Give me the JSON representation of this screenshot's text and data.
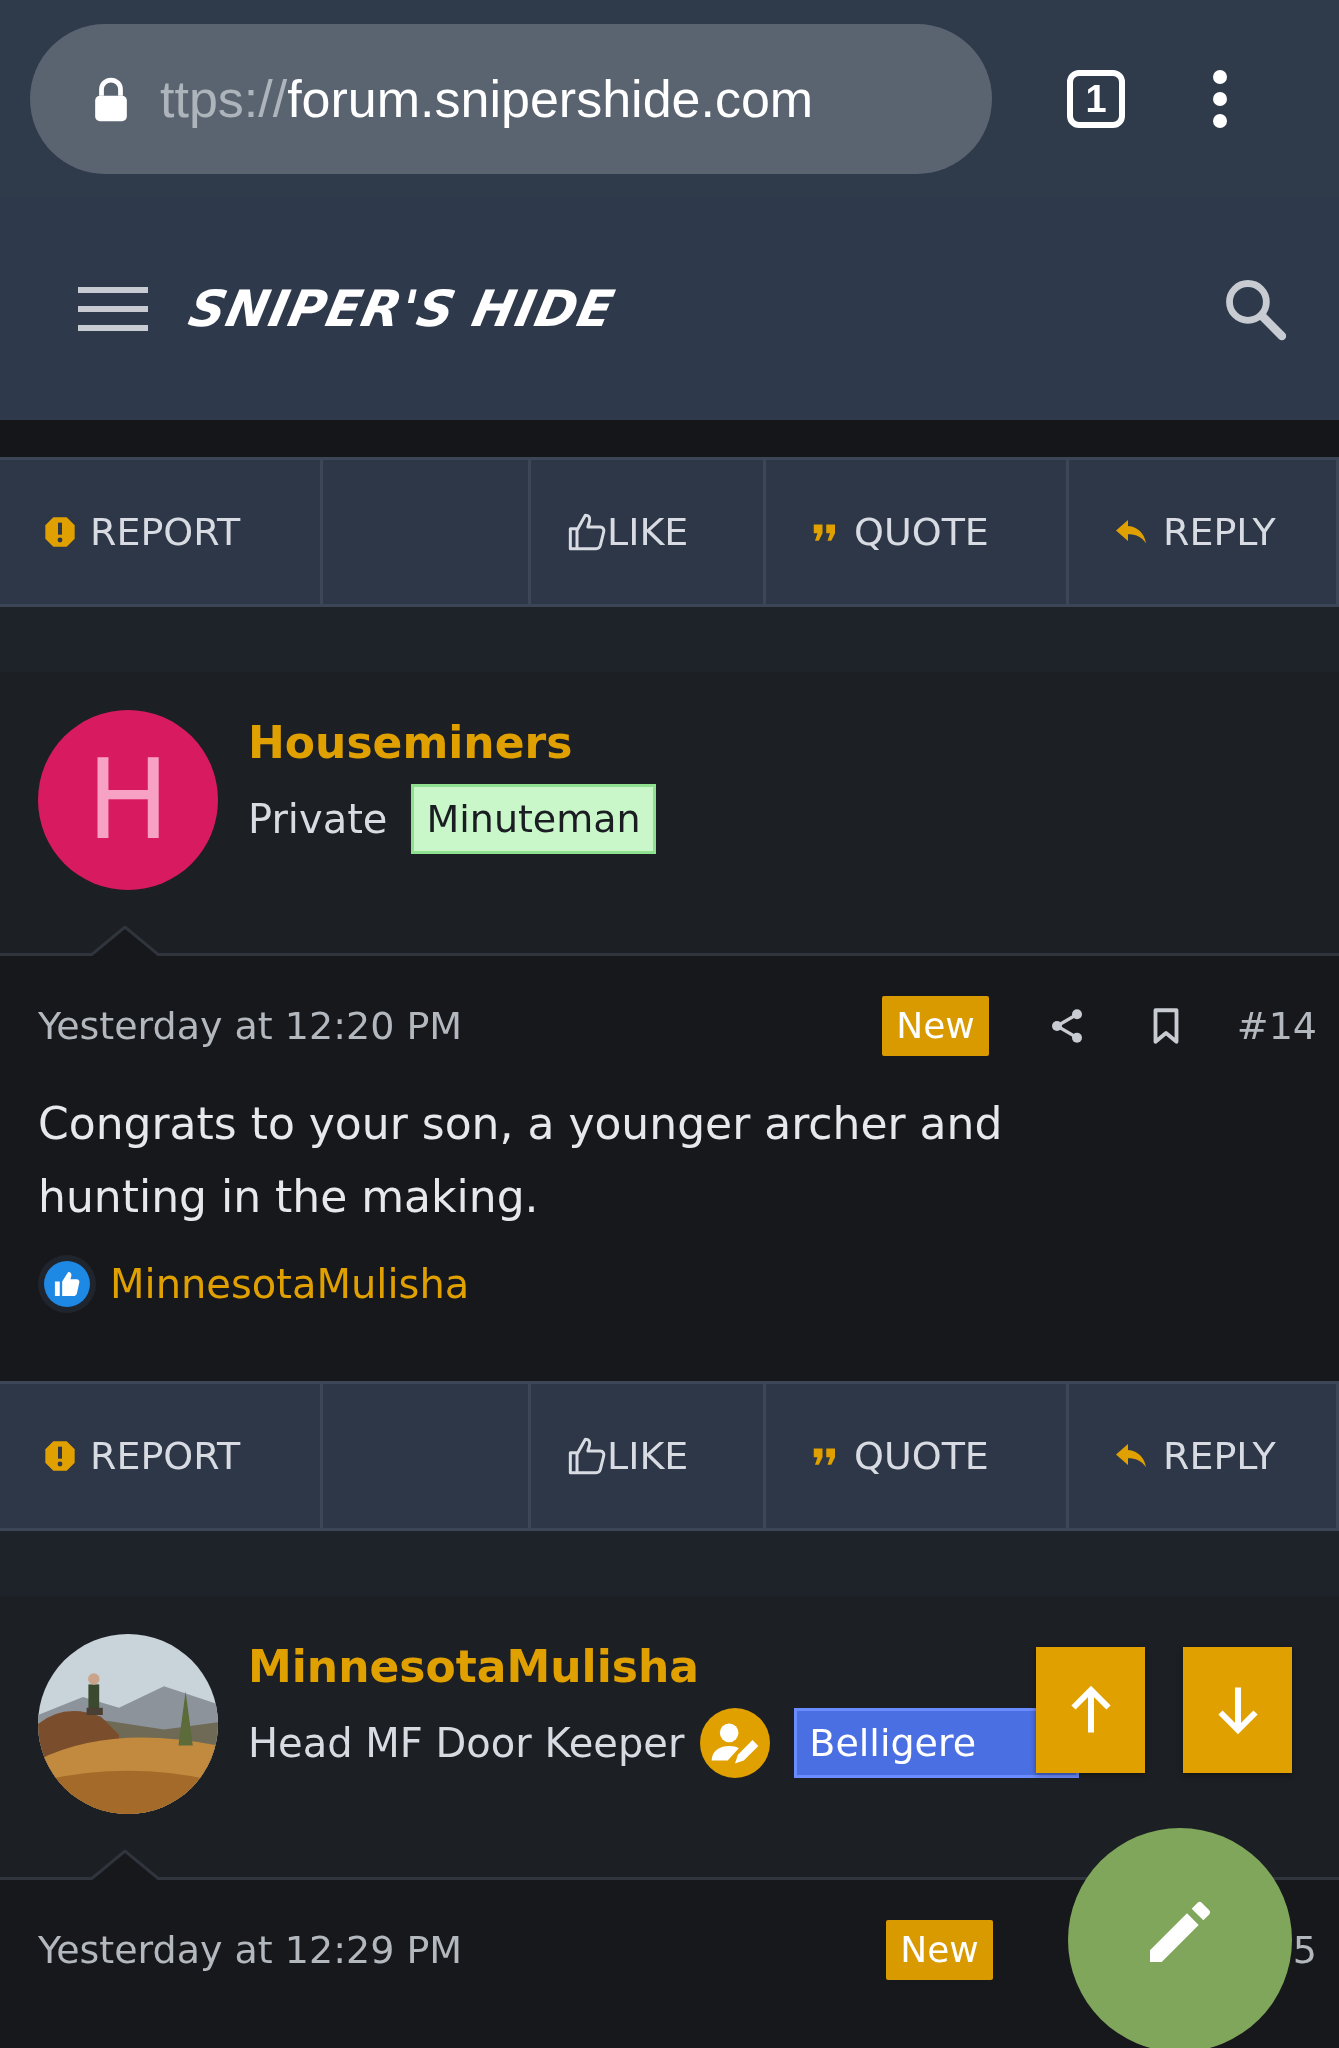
{
  "browser": {
    "url_scheme": "ttps://",
    "url_host": "forum.snipershide.com",
    "tab_count": "1"
  },
  "site_header": {
    "logo": "SNIPER'S HIDE"
  },
  "thread": [
    {
      "kind": "actions",
      "actions": [
        {
          "kind": "report",
          "label": "REPORT"
        },
        {
          "kind": "spacer"
        },
        {
          "kind": "like",
          "label": "LIKE"
        },
        {
          "kind": "quote",
          "label": "QUOTE"
        },
        {
          "kind": "reply",
          "label": "REPLY"
        }
      ]
    },
    {
      "kind": "post",
      "author": "Houseminers",
      "avatar": {
        "kind": "letter",
        "letter": "H"
      },
      "user_title": "Private",
      "role_icon": false,
      "banner": {
        "label": "Minuteman",
        "color": "#c9f7c9"
      },
      "date": "Yesterday at 12:20 PM",
      "badge": "New",
      "post_number": "#14",
      "body": "Congrats to your son, a younger archer and hunting in the making.",
      "reaction_user": "MinnesotaMulisha"
    },
    {
      "kind": "actions",
      "actions": [
        {
          "kind": "report",
          "label": "REPORT"
        },
        {
          "kind": "spacer"
        },
        {
          "kind": "like",
          "label": "LIKE"
        },
        {
          "kind": "quote",
          "label": "QUOTE"
        },
        {
          "kind": "reply",
          "label": "REPLY"
        }
      ]
    },
    {
      "kind": "post",
      "author": "MinnesotaMulisha",
      "user_title": "Head MF Door Keeper",
      "role_icon": true,
      "banner": {
        "label": "Belligere",
        "color": "#4a6fe3"
      },
      "date": "Yesterday at 12:29 PM",
      "badge": "New",
      "post_number": "5"
    }
  ]
}
